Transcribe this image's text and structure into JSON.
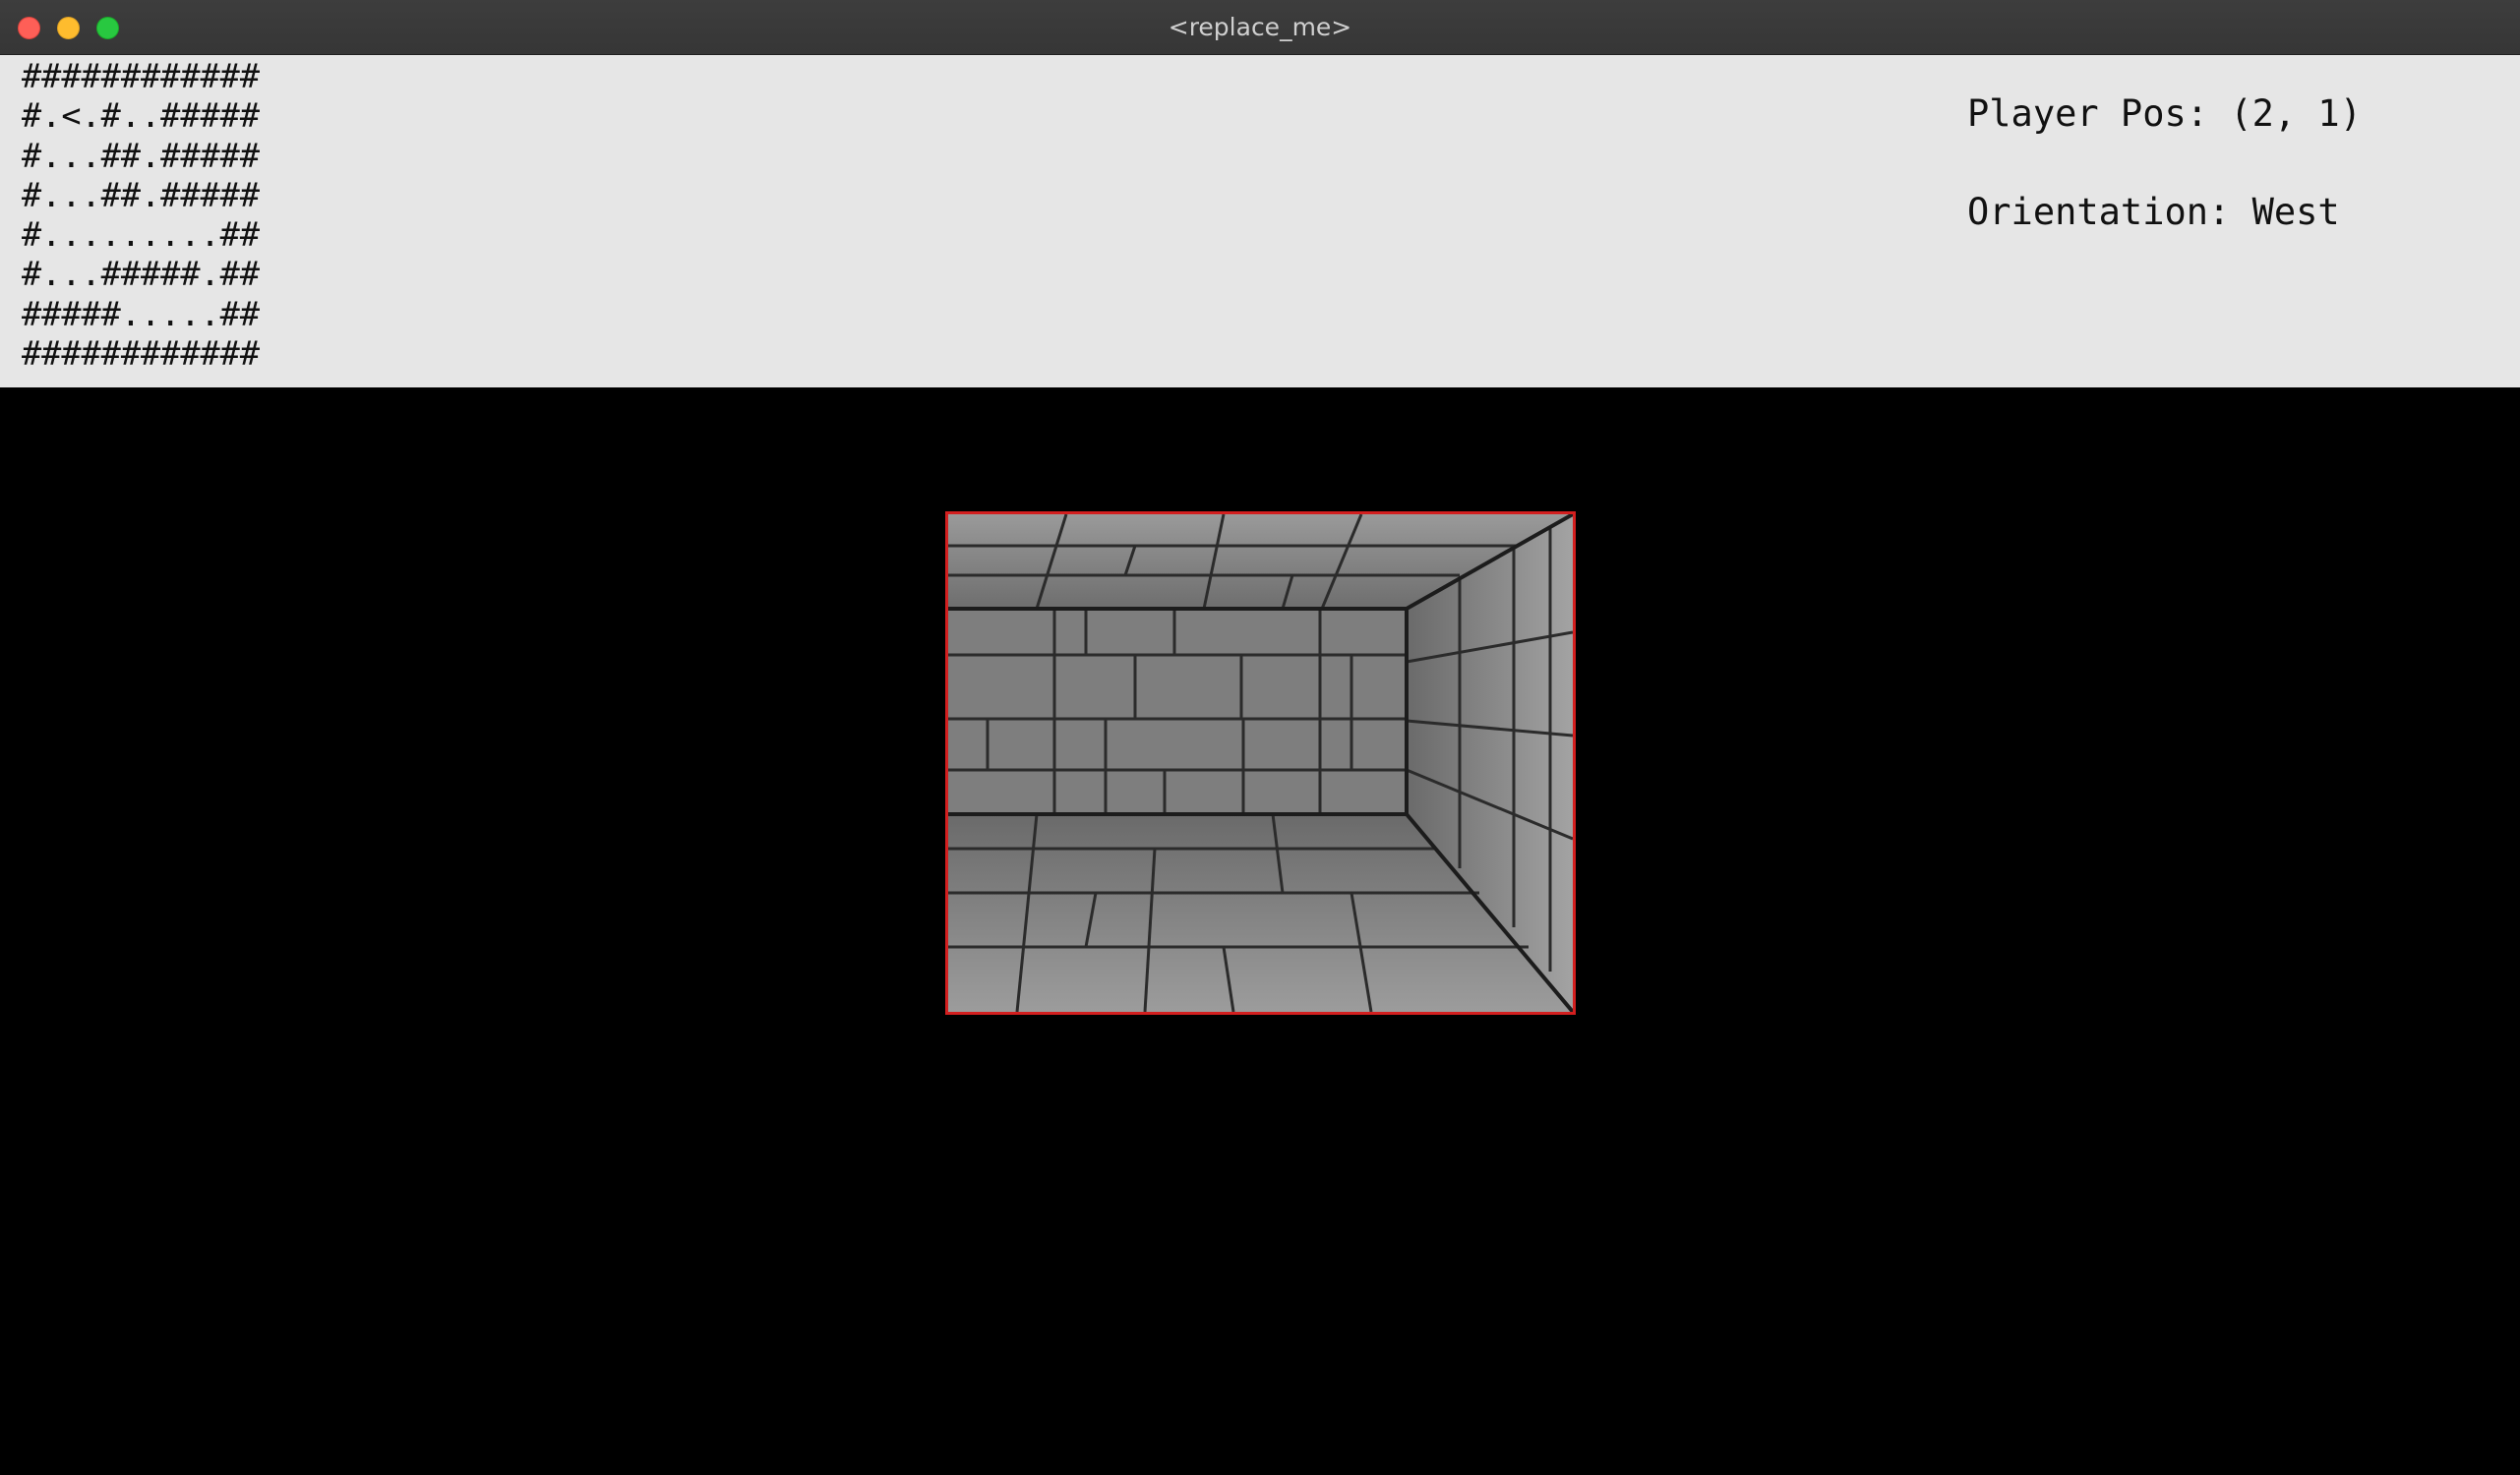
{
  "window": {
    "title": "<replace_me>"
  },
  "minimap": {
    "rows": [
      "############",
      "#.<.#..#####",
      "#...##.#####",
      "#...##.#####",
      "#.........##",
      "#...#####.##",
      "#####.....##",
      "############"
    ]
  },
  "status": {
    "player_pos": "Player Pos: (2, 1)",
    "orientation": "Orientation: West"
  },
  "view": {
    "border_color": "#d31f1f",
    "scene": "stone dungeon corridor: ceiling, back wall, right wall, floor"
  },
  "colors": {
    "hud_background": "#e6e6e6",
    "game_background": "#000000",
    "titlebar": "#3a3a3a"
  }
}
